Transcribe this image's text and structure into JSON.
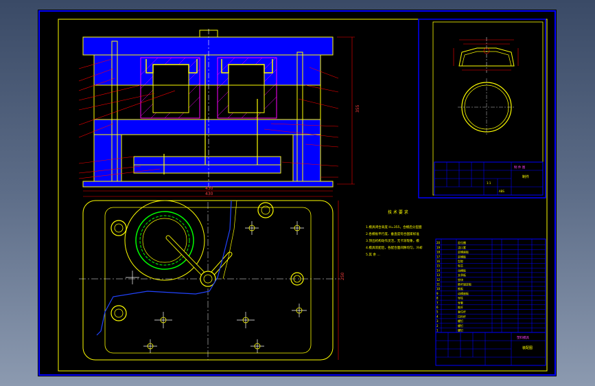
{
  "viewport": {
    "background": "#000000",
    "frame_color": "#0000ff"
  },
  "colors": {
    "outline": "#ffff00",
    "section": "#0000ff",
    "hatch": "#ff00ff",
    "center": "#ffffff",
    "leader": "#ff0000",
    "table": "#0000ff",
    "part_green": "#00ff00",
    "cyan": "#00ffff"
  },
  "drawing": {
    "section_dims": {
      "width": "430",
      "height": "355"
    },
    "plan_dims": {
      "width": "430",
      "height": "250"
    }
  },
  "tech_notes": {
    "title": "技 术 要 求",
    "lines": [
      "1.模具闭合高度 H=355，合模后分型面",
      "2.各模板平行度、垂直度符合国家标准",
      "3.顶出机构动作灵活，无卡滞现象，模",
      "4.模具装配后，各配合面间隙均匀，冷却",
      "5.其 余 ..."
    ]
  },
  "part_table": {
    "title": "制 件 图",
    "scale": "1:1",
    "material": "ABS",
    "sheet_label": "制件"
  },
  "assembly_table": {
    "title": "塑料模具",
    "sheet_label": "装配图",
    "rows": [
      "定位圈",
      "浇口套",
      "定模座板",
      "定模板",
      "型腔",
      "型芯",
      "动模板",
      "支承板",
      "垫块",
      "推杆固定板",
      "推板",
      "动模座板",
      "导柱",
      "导套",
      "推杆",
      "复位杆",
      "拉料杆",
      "螺钉",
      "螺钉",
      "螺钉"
    ]
  }
}
